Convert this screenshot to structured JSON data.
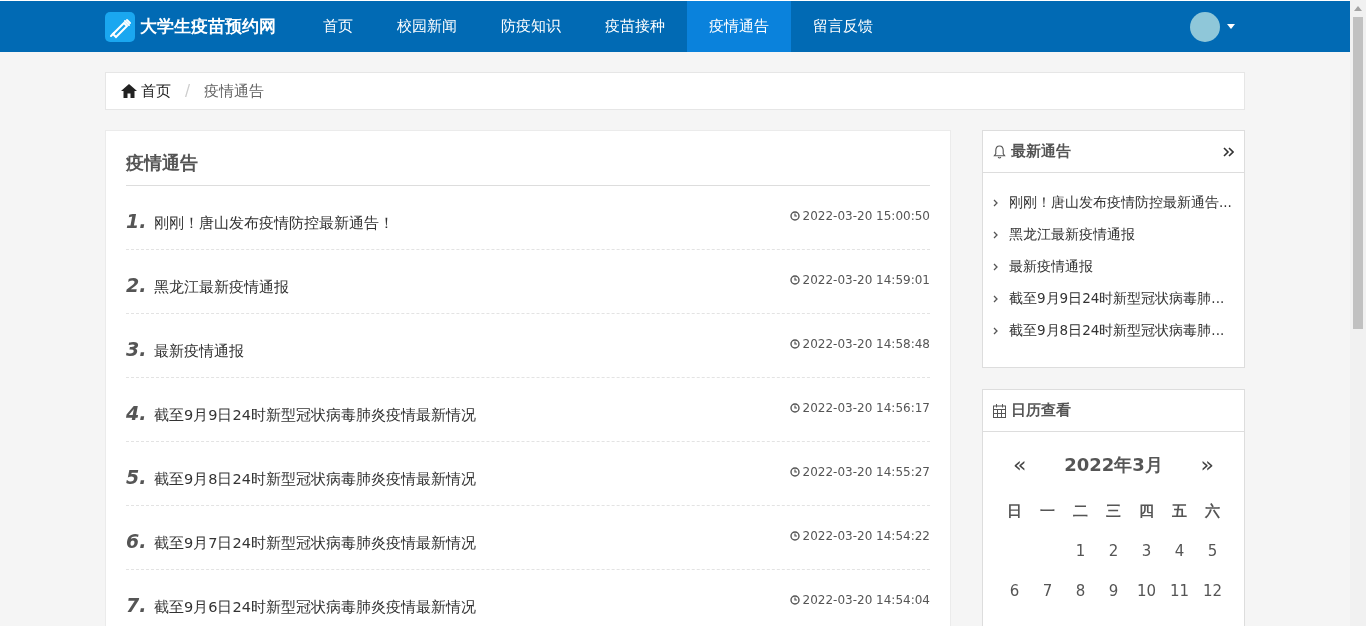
{
  "header": {
    "site_title": "大学生疫苗预约网",
    "nav": [
      {
        "label": "首页",
        "selected": false
      },
      {
        "label": "校园新闻",
        "selected": false
      },
      {
        "label": "防疫知识",
        "selected": false
      },
      {
        "label": "疫苗接种",
        "selected": false
      },
      {
        "label": "疫情通告",
        "selected": true
      },
      {
        "label": "留言反馈",
        "selected": false
      }
    ]
  },
  "breadcrumb": {
    "items": [
      "首页",
      "疫情通告"
    ],
    "separator": "/"
  },
  "main": {
    "title": "疫情通告",
    "items": [
      {
        "number": "1.",
        "title": "刚刚！唐山发布疫情防控最新通告！",
        "time": "2022-03-20 15:00:50"
      },
      {
        "number": "2.",
        "title": "黑龙江最新疫情通报",
        "time": "2022-03-20 14:59:01"
      },
      {
        "number": "3.",
        "title": "最新疫情通报",
        "time": "2022-03-20 14:58:48"
      },
      {
        "number": "4.",
        "title": "截至9月9日24时新型冠状病毒肺炎疫情最新情况",
        "time": "2022-03-20 14:56:17"
      },
      {
        "number": "5.",
        "title": "截至9月8日24时新型冠状病毒肺炎疫情最新情况",
        "time": "2022-03-20 14:55:27"
      },
      {
        "number": "6.",
        "title": "截至9月7日24时新型冠状病毒肺炎疫情最新情况",
        "time": "2022-03-20 14:54:22"
      },
      {
        "number": "7.",
        "title": "截至9月6日24时新型冠状病毒肺炎疫情最新情况",
        "time": "2022-03-20 14:54:04"
      }
    ]
  },
  "latest": {
    "title": "最新通告",
    "items": [
      "刚刚！唐山发布疫情防控最新通告...",
      "黑龙江最新疫情通报",
      "最新疫情通报",
      "截至9月9日24时新型冠状病毒肺...",
      "截至9月8日24时新型冠状病毒肺..."
    ]
  },
  "calendar": {
    "title": "日历查看",
    "month": "2022年3月",
    "prev": "«",
    "next": "»",
    "weekdays": [
      "日",
      "一",
      "二",
      "三",
      "四",
      "五",
      "六"
    ],
    "weeks": [
      {
        "kind": "start",
        "days": [
          "1",
          "2",
          "3",
          "4",
          "5"
        ]
      },
      {
        "kind": "full",
        "days": [
          "6",
          "7",
          "8",
          "9",
          "10",
          "11",
          "12"
        ]
      }
    ]
  }
}
